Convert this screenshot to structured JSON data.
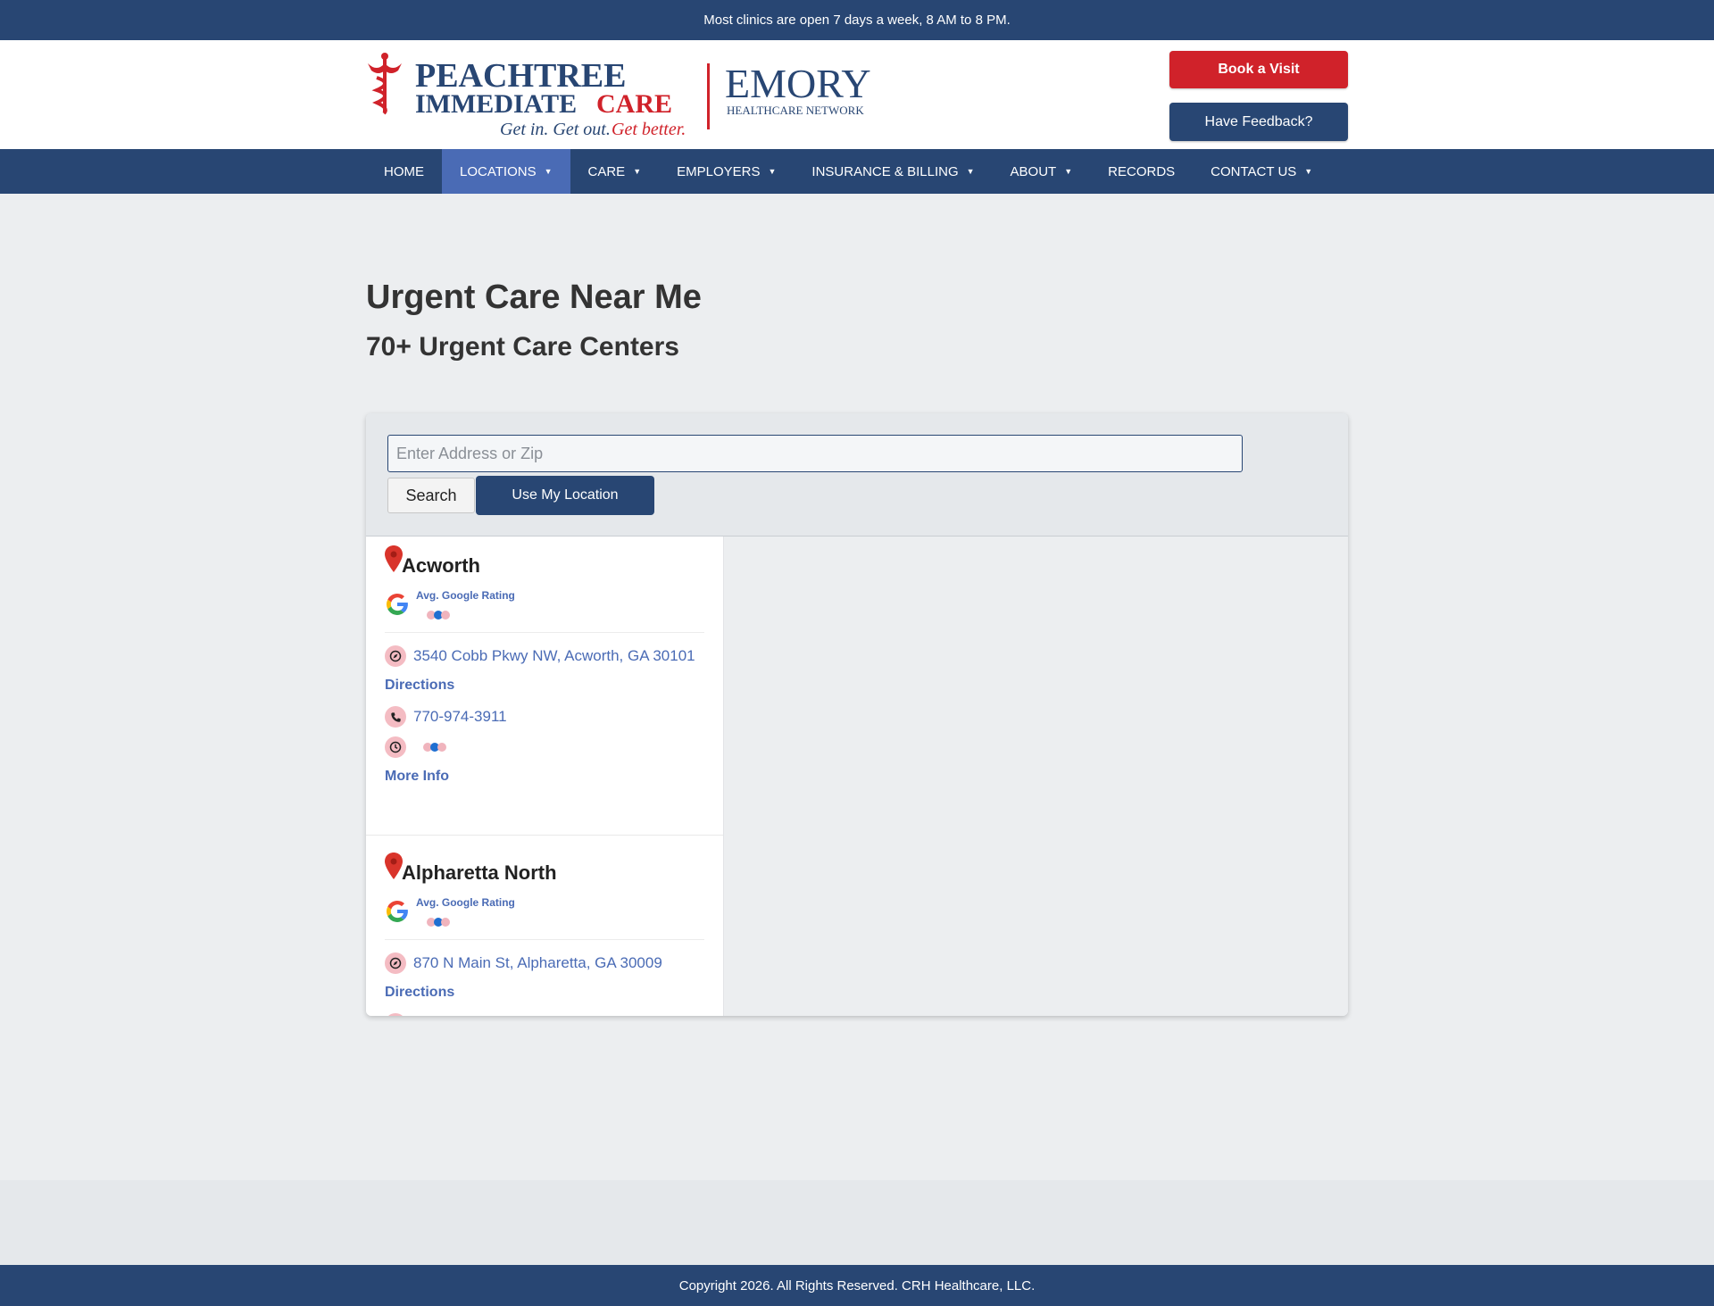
{
  "topbar": {
    "text": "Most clinics are open 7 days a week, 8 AM to 8 PM."
  },
  "header": {
    "logo": {
      "line1": "PEACHTREE",
      "line2_a": "IMMEDIATE",
      "line2_b": "CARE",
      "tagline_a": "Get in. Get out. ",
      "tagline_b": "Get better.",
      "partner": "EMORY",
      "partner_sub": "HEALTHCARE NETWORK"
    },
    "book_label": "Book a Visit",
    "feedback_label": "Have Feedback?"
  },
  "nav": {
    "items": [
      {
        "label": "HOME"
      },
      {
        "label": "LOCATIONS"
      },
      {
        "label": "CARE"
      },
      {
        "label": "EMPLOYERS"
      },
      {
        "label": "INSURANCE & BILLING"
      },
      {
        "label": "ABOUT"
      },
      {
        "label": "RECORDS"
      },
      {
        "label": "CONTACT US"
      }
    ],
    "active": "LOCATIONS",
    "caret": "▼"
  },
  "page": {
    "title": "Urgent Care Near Me",
    "subtitle": "70+ Urgent Care Centers"
  },
  "search": {
    "placeholder": "Enter Address or Zip",
    "value": "",
    "search_label": "Search",
    "location_label": "Use My Location"
  },
  "locations": [
    {
      "name": "Acworth",
      "rating_label": "Avg. Google Rating",
      "address": "3540 Cobb Pkwy NW, Acworth, GA 30101",
      "directions_label": "Directions",
      "phone": "770-974-3911",
      "more_info_label": "More Info"
    },
    {
      "name": "Alpharetta North",
      "rating_label": "Avg. Google Rating",
      "address": "870 N Main St, Alpharetta, GA 30009",
      "directions_label": "Directions"
    }
  ],
  "footer": {
    "copyright": "Copyright 2026. All Rights Reserved. CRH Healthcare, LLC."
  },
  "colors": {
    "navy": "#284673",
    "red": "#d0222a",
    "link": "#4a6bb5",
    "active_nav": "#4a6bb5"
  }
}
